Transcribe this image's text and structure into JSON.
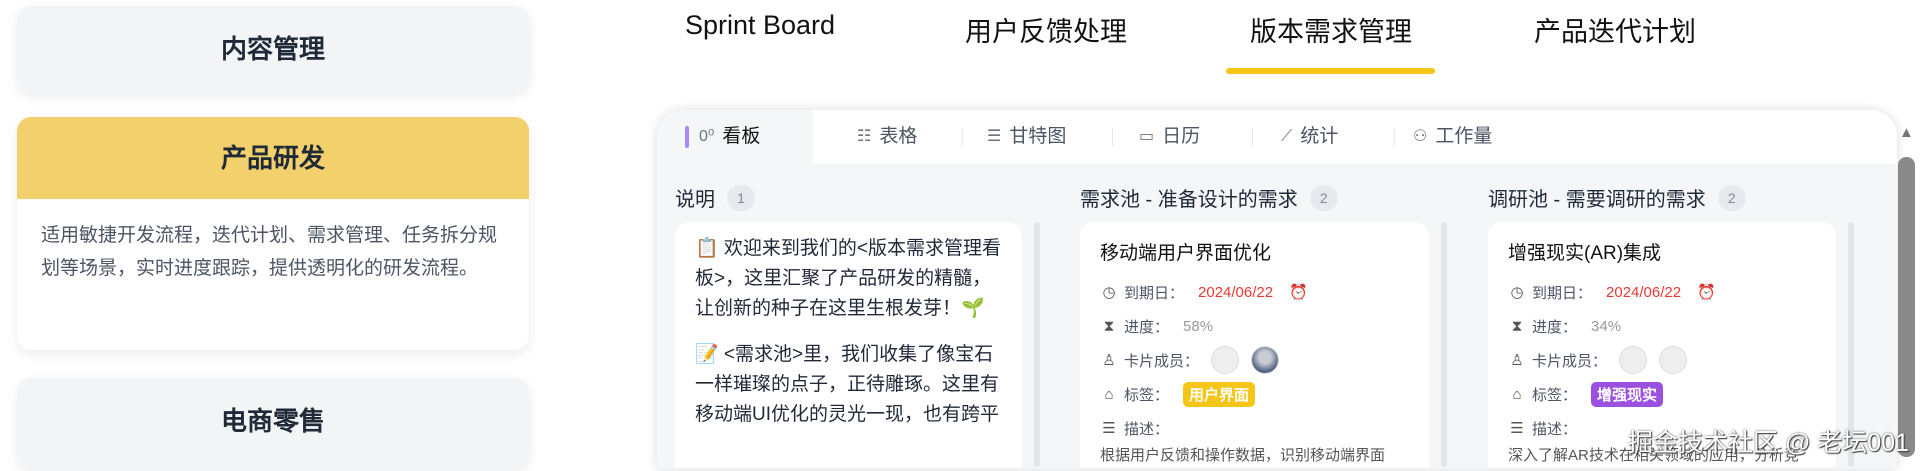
{
  "sidebar": {
    "cards": [
      {
        "title": "内容管理"
      },
      {
        "title": "产品研发",
        "description": "适用敏捷开发流程，迭代计划、需求管理、任务拆分规划等场景，实时进度跟踪，提供透明化的研发流程。"
      },
      {
        "title": "电商零售"
      }
    ]
  },
  "top_tabs": [
    "Sprint Board",
    "用户反馈处理",
    "版本需求管理",
    "产品迭代计划"
  ],
  "active_top_tab": "版本需求管理",
  "views": [
    {
      "icon": "kanban-icon",
      "glyph": "0⁰",
      "label": "看板"
    },
    {
      "icon": "list-icon",
      "glyph": "☷",
      "label": "表格"
    },
    {
      "icon": "gantt-icon",
      "glyph": "☰",
      "label": "甘特图"
    },
    {
      "icon": "calendar-icon",
      "glyph": "▭",
      "label": "日历"
    },
    {
      "icon": "chart-icon",
      "glyph": "⟋",
      "label": "统计"
    },
    {
      "icon": "workload-icon",
      "glyph": "⚇",
      "label": "工作量"
    }
  ],
  "columns": [
    {
      "title": "说明",
      "count": "1"
    },
    {
      "title": "需求池 - 准备设计的需求",
      "count": "2"
    },
    {
      "title": "调研池 - 需要调研的需求",
      "count": "2"
    }
  ],
  "intro_card": {
    "p1": "📋 欢迎来到我们的<版本需求管理看板>，这里汇聚了产品研发的精髓，让创新的种子在这里生根发芽！🌱",
    "p2": "📝 <需求池>里，我们收集了像宝石一样璀璨的点子，正待雕琢。这里有移动端UI优化的灵光一现，也有跨平"
  },
  "labels": {
    "due": "到期日：",
    "progress": "进度：",
    "members": "卡片成员：",
    "tags": "标签：",
    "desc": "描述："
  },
  "cards": [
    {
      "title": "移动端用户界面优化",
      "due": "2024/06/22",
      "progress": "58%",
      "tag": "用户界面",
      "tag_color": "#f5c518",
      "description": "根据用户反馈和操作数据，识别移动端界面"
    },
    {
      "title": "增强现实(AR)集成",
      "due": "2024/06/22",
      "progress": "34%",
      "tag": "增强现实",
      "tag_color": "#9b51e0",
      "description": "深入了解AR技术在相关领域的应用，分析竞"
    }
  ],
  "watermark": "掘金技术社区 @ 老坛001"
}
